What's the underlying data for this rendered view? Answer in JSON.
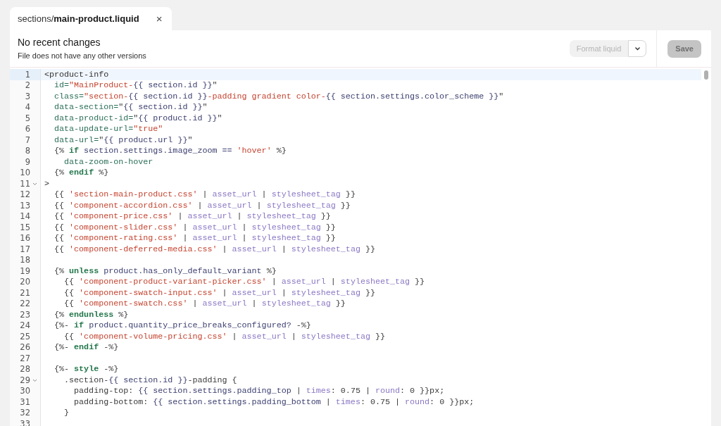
{
  "tab": {
    "path": "sections/",
    "file": "main-product.liquid",
    "close": "×"
  },
  "header": {
    "title": "No recent changes",
    "subtitle": "File does not have any other versions"
  },
  "format_button": {
    "label": "Format liquid",
    "disabled": true
  },
  "save_button": {
    "label": "Save",
    "disabled": true
  },
  "lines": [
    {
      "number": "1",
      "selected": true,
      "foldable": false,
      "tokens": [
        {
          "kind": "tag",
          "text": "<product-info"
        }
      ]
    },
    {
      "number": "2",
      "selected": false,
      "foldable": false,
      "tokens": [
        {
          "kind": "attr",
          "text": "  id="
        },
        {
          "kind": "str",
          "text": "\"MainProduct-"
        },
        {
          "kind": "var",
          "text": "{{ section.id }}"
        },
        {
          "kind": "plain",
          "text": "\""
        }
      ]
    },
    {
      "number": "3",
      "selected": false,
      "foldable": false,
      "tokens": [
        {
          "kind": "attr",
          "text": "  class="
        },
        {
          "kind": "str",
          "text": "\"section-"
        },
        {
          "kind": "var",
          "text": "{{ section.id }}"
        },
        {
          "kind": "str",
          "text": "-padding gradient color-"
        },
        {
          "kind": "var",
          "text": "{{ section.settings.color_scheme }}"
        },
        {
          "kind": "plain",
          "text": "\""
        }
      ]
    },
    {
      "number": "4",
      "selected": false,
      "foldable": false,
      "tokens": [
        {
          "kind": "attr",
          "text": "  data-section="
        },
        {
          "kind": "plain",
          "text": "\""
        },
        {
          "kind": "var",
          "text": "{{ section.id }}"
        },
        {
          "kind": "plain",
          "text": "\""
        }
      ]
    },
    {
      "number": "5",
      "selected": false,
      "foldable": false,
      "tokens": [
        {
          "kind": "attr",
          "text": "  data-product-id="
        },
        {
          "kind": "plain",
          "text": "\""
        },
        {
          "kind": "var",
          "text": "{{ product.id }}"
        },
        {
          "kind": "plain",
          "text": "\""
        }
      ]
    },
    {
      "number": "6",
      "selected": false,
      "foldable": false,
      "tokens": [
        {
          "kind": "attr",
          "text": "  data-update-url="
        },
        {
          "kind": "str",
          "text": "\"true\""
        }
      ]
    },
    {
      "number": "7",
      "selected": false,
      "foldable": false,
      "tokens": [
        {
          "kind": "attr",
          "text": "  data-url="
        },
        {
          "kind": "plain",
          "text": "\""
        },
        {
          "kind": "var",
          "text": "{{ product.url }}"
        },
        {
          "kind": "plain",
          "text": "\""
        }
      ]
    },
    {
      "number": "8",
      "selected": false,
      "foldable": false,
      "tokens": [
        {
          "kind": "plain",
          "text": "  {% "
        },
        {
          "kind": "kw",
          "text": "if"
        },
        {
          "kind": "var",
          "text": " section.settings.image_zoom == "
        },
        {
          "kind": "str",
          "text": "'hover'"
        },
        {
          "kind": "plain",
          "text": " %}"
        }
      ]
    },
    {
      "number": "9",
      "selected": false,
      "foldable": false,
      "tokens": [
        {
          "kind": "attr",
          "text": "    data-zoom-on-hover"
        }
      ]
    },
    {
      "number": "10",
      "selected": false,
      "foldable": false,
      "tokens": [
        {
          "kind": "plain",
          "text": "  {% "
        },
        {
          "kind": "kw",
          "text": "endif"
        },
        {
          "kind": "plain",
          "text": " %}"
        }
      ]
    },
    {
      "number": "11",
      "selected": false,
      "foldable": true,
      "tokens": [
        {
          "kind": "tag",
          "text": ">"
        }
      ]
    },
    {
      "number": "12",
      "selected": false,
      "foldable": false,
      "tokens": [
        {
          "kind": "plain",
          "text": "  {{ "
        },
        {
          "kind": "str",
          "text": "'section-main-product.css'"
        },
        {
          "kind": "plain",
          "text": " | "
        },
        {
          "kind": "filter",
          "text": "asset_url"
        },
        {
          "kind": "plain",
          "text": " | "
        },
        {
          "kind": "filter",
          "text": "stylesheet_tag"
        },
        {
          "kind": "plain",
          "text": " }}"
        }
      ]
    },
    {
      "number": "13",
      "selected": false,
      "foldable": false,
      "tokens": [
        {
          "kind": "plain",
          "text": "  {{ "
        },
        {
          "kind": "str",
          "text": "'component-accordion.css'"
        },
        {
          "kind": "plain",
          "text": " | "
        },
        {
          "kind": "filter",
          "text": "asset_url"
        },
        {
          "kind": "plain",
          "text": " | "
        },
        {
          "kind": "filter",
          "text": "stylesheet_tag"
        },
        {
          "kind": "plain",
          "text": " }}"
        }
      ]
    },
    {
      "number": "14",
      "selected": false,
      "foldable": false,
      "tokens": [
        {
          "kind": "plain",
          "text": "  {{ "
        },
        {
          "kind": "str",
          "text": "'component-price.css'"
        },
        {
          "kind": "plain",
          "text": " | "
        },
        {
          "kind": "filter",
          "text": "asset_url"
        },
        {
          "kind": "plain",
          "text": " | "
        },
        {
          "kind": "filter",
          "text": "stylesheet_tag"
        },
        {
          "kind": "plain",
          "text": " }}"
        }
      ]
    },
    {
      "number": "15",
      "selected": false,
      "foldable": false,
      "tokens": [
        {
          "kind": "plain",
          "text": "  {{ "
        },
        {
          "kind": "str",
          "text": "'component-slider.css'"
        },
        {
          "kind": "plain",
          "text": " | "
        },
        {
          "kind": "filter",
          "text": "asset_url"
        },
        {
          "kind": "plain",
          "text": " | "
        },
        {
          "kind": "filter",
          "text": "stylesheet_tag"
        },
        {
          "kind": "plain",
          "text": " }}"
        }
      ]
    },
    {
      "number": "16",
      "selected": false,
      "foldable": false,
      "tokens": [
        {
          "kind": "plain",
          "text": "  {{ "
        },
        {
          "kind": "str",
          "text": "'component-rating.css'"
        },
        {
          "kind": "plain",
          "text": " | "
        },
        {
          "kind": "filter",
          "text": "asset_url"
        },
        {
          "kind": "plain",
          "text": " | "
        },
        {
          "kind": "filter",
          "text": "stylesheet_tag"
        },
        {
          "kind": "plain",
          "text": " }}"
        }
      ]
    },
    {
      "number": "17",
      "selected": false,
      "foldable": false,
      "tokens": [
        {
          "kind": "plain",
          "text": "  {{ "
        },
        {
          "kind": "str",
          "text": "'component-deferred-media.css'"
        },
        {
          "kind": "plain",
          "text": " | "
        },
        {
          "kind": "filter",
          "text": "asset_url"
        },
        {
          "kind": "plain",
          "text": " | "
        },
        {
          "kind": "filter",
          "text": "stylesheet_tag"
        },
        {
          "kind": "plain",
          "text": " }}"
        }
      ]
    },
    {
      "number": "18",
      "selected": false,
      "foldable": false
    },
    {
      "number": "19",
      "selected": false,
      "foldable": false,
      "tokens": [
        {
          "kind": "plain",
          "text": "  {% "
        },
        {
          "kind": "kw",
          "text": "unless"
        },
        {
          "kind": "var",
          "text": " product.has_only_default_variant"
        },
        {
          "kind": "plain",
          "text": " %}"
        }
      ]
    },
    {
      "number": "20",
      "selected": false,
      "foldable": false,
      "tokens": [
        {
          "kind": "plain",
          "text": "    {{ "
        },
        {
          "kind": "str",
          "text": "'component-product-variant-picker.css'"
        },
        {
          "kind": "plain",
          "text": " | "
        },
        {
          "kind": "filter",
          "text": "asset_url"
        },
        {
          "kind": "plain",
          "text": " | "
        },
        {
          "kind": "filter",
          "text": "stylesheet_tag"
        },
        {
          "kind": "plain",
          "text": " }}"
        }
      ]
    },
    {
      "number": "21",
      "selected": false,
      "foldable": false,
      "tokens": [
        {
          "kind": "plain",
          "text": "    {{ "
        },
        {
          "kind": "str",
          "text": "'component-swatch-input.css'"
        },
        {
          "kind": "plain",
          "text": " | "
        },
        {
          "kind": "filter",
          "text": "asset_url"
        },
        {
          "kind": "plain",
          "text": " | "
        },
        {
          "kind": "filter",
          "text": "stylesheet_tag"
        },
        {
          "kind": "plain",
          "text": " }}"
        }
      ]
    },
    {
      "number": "22",
      "selected": false,
      "foldable": false,
      "tokens": [
        {
          "kind": "plain",
          "text": "    {{ "
        },
        {
          "kind": "str",
          "text": "'component-swatch.css'"
        },
        {
          "kind": "plain",
          "text": " | "
        },
        {
          "kind": "filter",
          "text": "asset_url"
        },
        {
          "kind": "plain",
          "text": " | "
        },
        {
          "kind": "filter",
          "text": "stylesheet_tag"
        },
        {
          "kind": "plain",
          "text": " }}"
        }
      ]
    },
    {
      "number": "23",
      "selected": false,
      "foldable": false,
      "tokens": [
        {
          "kind": "plain",
          "text": "  {% "
        },
        {
          "kind": "kw",
          "text": "endunless"
        },
        {
          "kind": "plain",
          "text": " %}"
        }
      ]
    },
    {
      "number": "24",
      "selected": false,
      "foldable": false,
      "tokens": [
        {
          "kind": "plain",
          "text": "  {%- "
        },
        {
          "kind": "kw",
          "text": "if"
        },
        {
          "kind": "var",
          "text": " product.quantity_price_breaks_configured?"
        },
        {
          "kind": "plain",
          "text": " -%}"
        }
      ]
    },
    {
      "number": "25",
      "selected": false,
      "foldable": false,
      "tokens": [
        {
          "kind": "plain",
          "text": "    {{ "
        },
        {
          "kind": "str",
          "text": "'component-volume-pricing.css'"
        },
        {
          "kind": "plain",
          "text": " | "
        },
        {
          "kind": "filter",
          "text": "asset_url"
        },
        {
          "kind": "plain",
          "text": " | "
        },
        {
          "kind": "filter",
          "text": "stylesheet_tag"
        },
        {
          "kind": "plain",
          "text": " }}"
        }
      ]
    },
    {
      "number": "26",
      "selected": false,
      "foldable": false,
      "tokens": [
        {
          "kind": "plain",
          "text": "  {%- "
        },
        {
          "kind": "kw",
          "text": "endif"
        },
        {
          "kind": "plain",
          "text": " -%}"
        }
      ]
    },
    {
      "number": "27",
      "selected": false,
      "foldable": false
    },
    {
      "number": "28",
      "selected": false,
      "foldable": false,
      "tokens": [
        {
          "kind": "plain",
          "text": "  {%- "
        },
        {
          "kind": "kw",
          "text": "style"
        },
        {
          "kind": "plain",
          "text": " -%}"
        }
      ]
    },
    {
      "number": "29",
      "selected": false,
      "foldable": true,
      "tokens": [
        {
          "kind": "plain",
          "text": "    .section-"
        },
        {
          "kind": "var",
          "text": "{{ section.id }}"
        },
        {
          "kind": "plain",
          "text": "-padding {"
        }
      ]
    },
    {
      "number": "30",
      "selected": false,
      "foldable": false,
      "tokens": [
        {
          "kind": "plain",
          "text": "      padding-top: "
        },
        {
          "kind": "var",
          "text": "{{ section.settings.padding_top"
        },
        {
          "kind": "plain",
          "text": " | "
        },
        {
          "kind": "filter",
          "text": "times"
        },
        {
          "kind": "plain",
          "text": ": 0.75 | "
        },
        {
          "kind": "filter",
          "text": "round"
        },
        {
          "kind": "plain",
          "text": ": 0 }}px;"
        }
      ]
    },
    {
      "number": "31",
      "selected": false,
      "foldable": false,
      "tokens": [
        {
          "kind": "plain",
          "text": "      padding-bottom: "
        },
        {
          "kind": "var",
          "text": "{{ section.settings.padding_bottom"
        },
        {
          "kind": "plain",
          "text": " | "
        },
        {
          "kind": "filter",
          "text": "times"
        },
        {
          "kind": "plain",
          "text": ": 0.75 | "
        },
        {
          "kind": "filter",
          "text": "round"
        },
        {
          "kind": "plain",
          "text": ": 0 }}px;"
        }
      ]
    },
    {
      "number": "32",
      "selected": false,
      "foldable": false,
      "tokens": [
        {
          "kind": "plain",
          "text": "    }"
        }
      ]
    },
    {
      "number": "33",
      "selected": false,
      "foldable": false
    }
  ]
}
